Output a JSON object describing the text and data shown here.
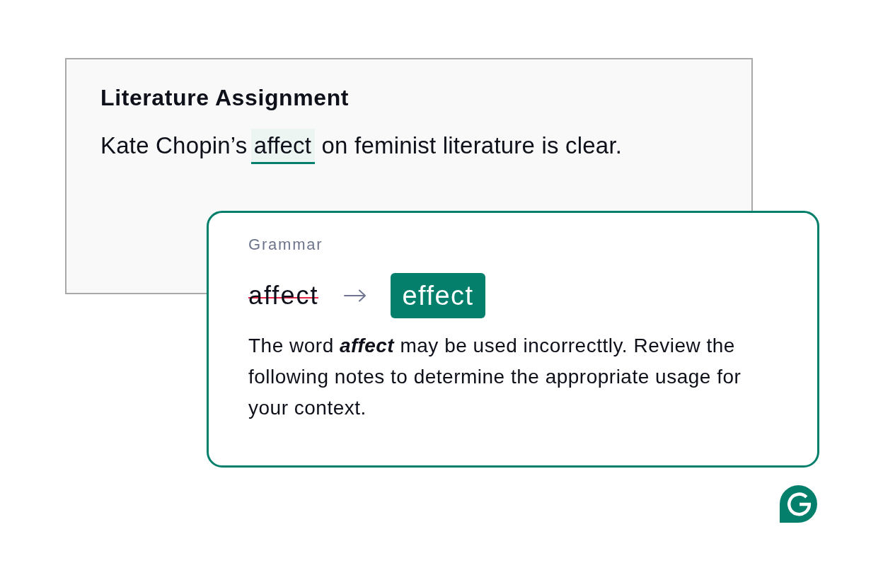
{
  "document": {
    "title": "Literature Assignment",
    "sentence": [
      {
        "text": "Kate Chopin’s ",
        "flagged": false
      },
      {
        "text": "affect",
        "flagged": true
      },
      {
        "text": " on feminist literature is clear.",
        "flagged": false
      }
    ]
  },
  "suggestion": {
    "category": "Grammar",
    "original": "affect",
    "original_struck": true,
    "replacement": "effect",
    "explanation": "The word **affect** may be used incorrecttly. Review the following notes to determine the appropriate usage for your context."
  }
}
